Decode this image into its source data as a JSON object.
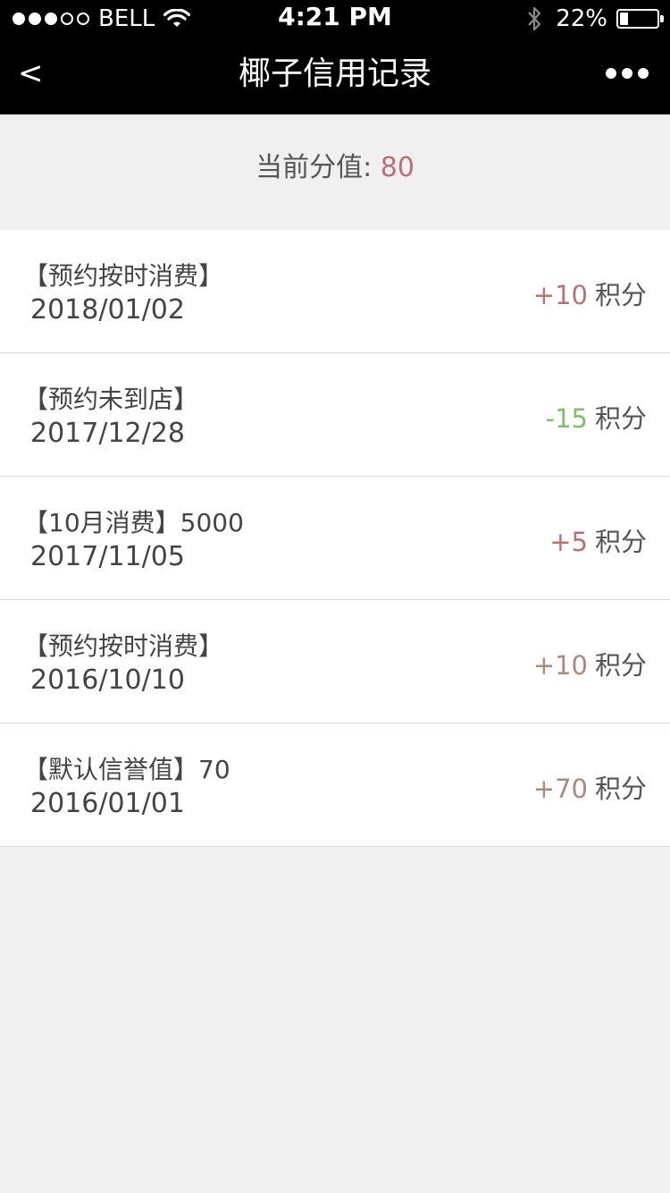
{
  "status_bar": {
    "carrier": "BELL",
    "signal_filled": 3,
    "signal_total": 5,
    "time": "4:21 PM",
    "battery_percent": "22%",
    "battery_level": 0.22
  },
  "nav": {
    "back_label": "<",
    "title": "椰子信用记录",
    "more_icon": "more-dots-icon"
  },
  "summary": {
    "label": "当前分值: ",
    "value": "80"
  },
  "records": [
    {
      "title": "【预约按时消费】",
      "date": "2018/01/02",
      "delta": "+10",
      "unit": "积分",
      "color": "#b87276"
    },
    {
      "title": "【预约未到店】",
      "date": "2017/12/28",
      "delta": "-15",
      "unit": "积分",
      "color": "#7fbf6a"
    },
    {
      "title": "【10月消费】5000",
      "date": "2017/11/05",
      "delta": "+5",
      "unit": "积分",
      "color": "#b87276"
    },
    {
      "title": "【预约按时消费】",
      "date": "2016/10/10",
      "delta": "+10",
      "unit": "积分",
      "color": "#a98a7f"
    },
    {
      "title": "【默认信誉值】70",
      "date": "2016/01/01",
      "delta": "+70",
      "unit": "积分",
      "color": "#a98a7f"
    }
  ],
  "colors": {
    "header_bg": "#000000",
    "accent": "#b87276",
    "negative": "#7fbf6a",
    "page_bg": "#f0f0f0"
  }
}
